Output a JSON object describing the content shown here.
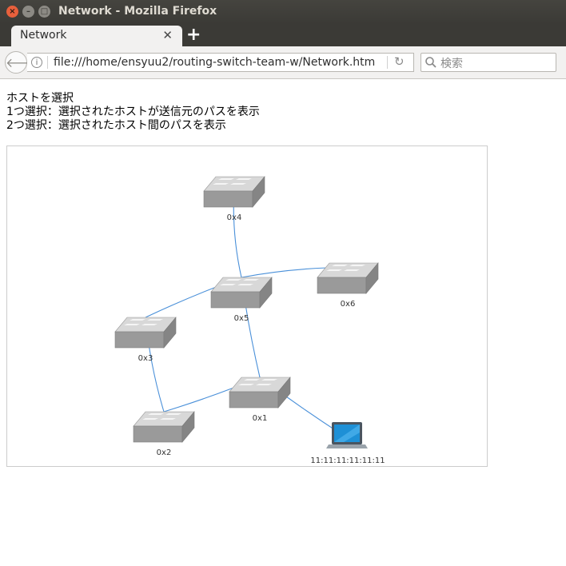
{
  "window": {
    "title": "Network - Mozilla Firefox"
  },
  "tabs": [
    {
      "label": "Network"
    }
  ],
  "toolbar": {
    "url": "file:///home/ensyuu2/routing-switch-team-w/Network.htm",
    "search_placeholder": "検索"
  },
  "instructions": {
    "line1": "ホストを選択",
    "line2": "1つ選択：選択されたホストが送信元のパスを表示",
    "line3": "2つ選択：選択されたホスト間のパスを表示"
  },
  "network": {
    "link_color": "#4a90d9",
    "switch_color": "#9a9a9a",
    "nodes": [
      {
        "id": "0x4",
        "type": "switch",
        "label": "0x4"
      },
      {
        "id": "0x5",
        "type": "switch",
        "label": "0x5"
      },
      {
        "id": "0x6",
        "type": "switch",
        "label": "0x6"
      },
      {
        "id": "0x3",
        "type": "switch",
        "label": "0x3"
      },
      {
        "id": "0x1",
        "type": "switch",
        "label": "0x1"
      },
      {
        "id": "0x2",
        "type": "switch",
        "label": "0x2"
      },
      {
        "id": "host1",
        "type": "host",
        "label": "11:11:11:11:11:11"
      }
    ],
    "links": [
      [
        "0x4",
        "0x5"
      ],
      [
        "0x5",
        "0x6"
      ],
      [
        "0x5",
        "0x3"
      ],
      [
        "0x5",
        "0x1"
      ],
      [
        "0x3",
        "0x2"
      ],
      [
        "0x2",
        "0x1"
      ],
      [
        "0x1",
        "host1"
      ]
    ]
  }
}
